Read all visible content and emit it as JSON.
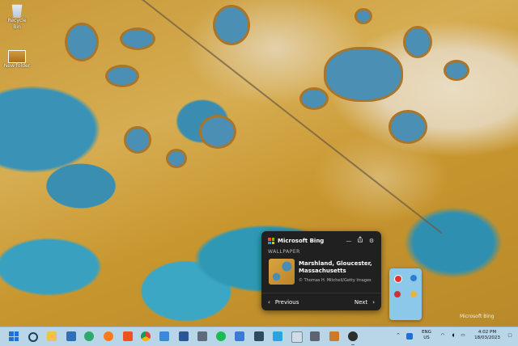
{
  "desktop": {
    "icons": [
      {
        "label": "Recycle Bin",
        "icon": "recycle-bin-icon"
      },
      {
        "label": "New folder",
        "icon": "folder-thumbnail-icon"
      }
    ]
  },
  "bing_widget": {
    "title": "Microsoft Bing",
    "section_label": "WALLPAPER",
    "wallpaper_title": "Marshland, Gloucester, Massachusetts",
    "wallpaper_credit": "© Thomas H. Mitchell/Getty Images",
    "previous_label": "Previous",
    "next_label": "Next",
    "colors": {
      "panel_bg": "#202020",
      "logo": [
        "#f25022",
        "#7fba00",
        "#00a4ef",
        "#ffb900"
      ]
    }
  },
  "watermark": "Microsoft Bing",
  "taskbar": {
    "language": "ENG",
    "region": "US",
    "time": "4:02 PM",
    "date": "18/03/2023",
    "bg_color": "#b9d6e8"
  }
}
